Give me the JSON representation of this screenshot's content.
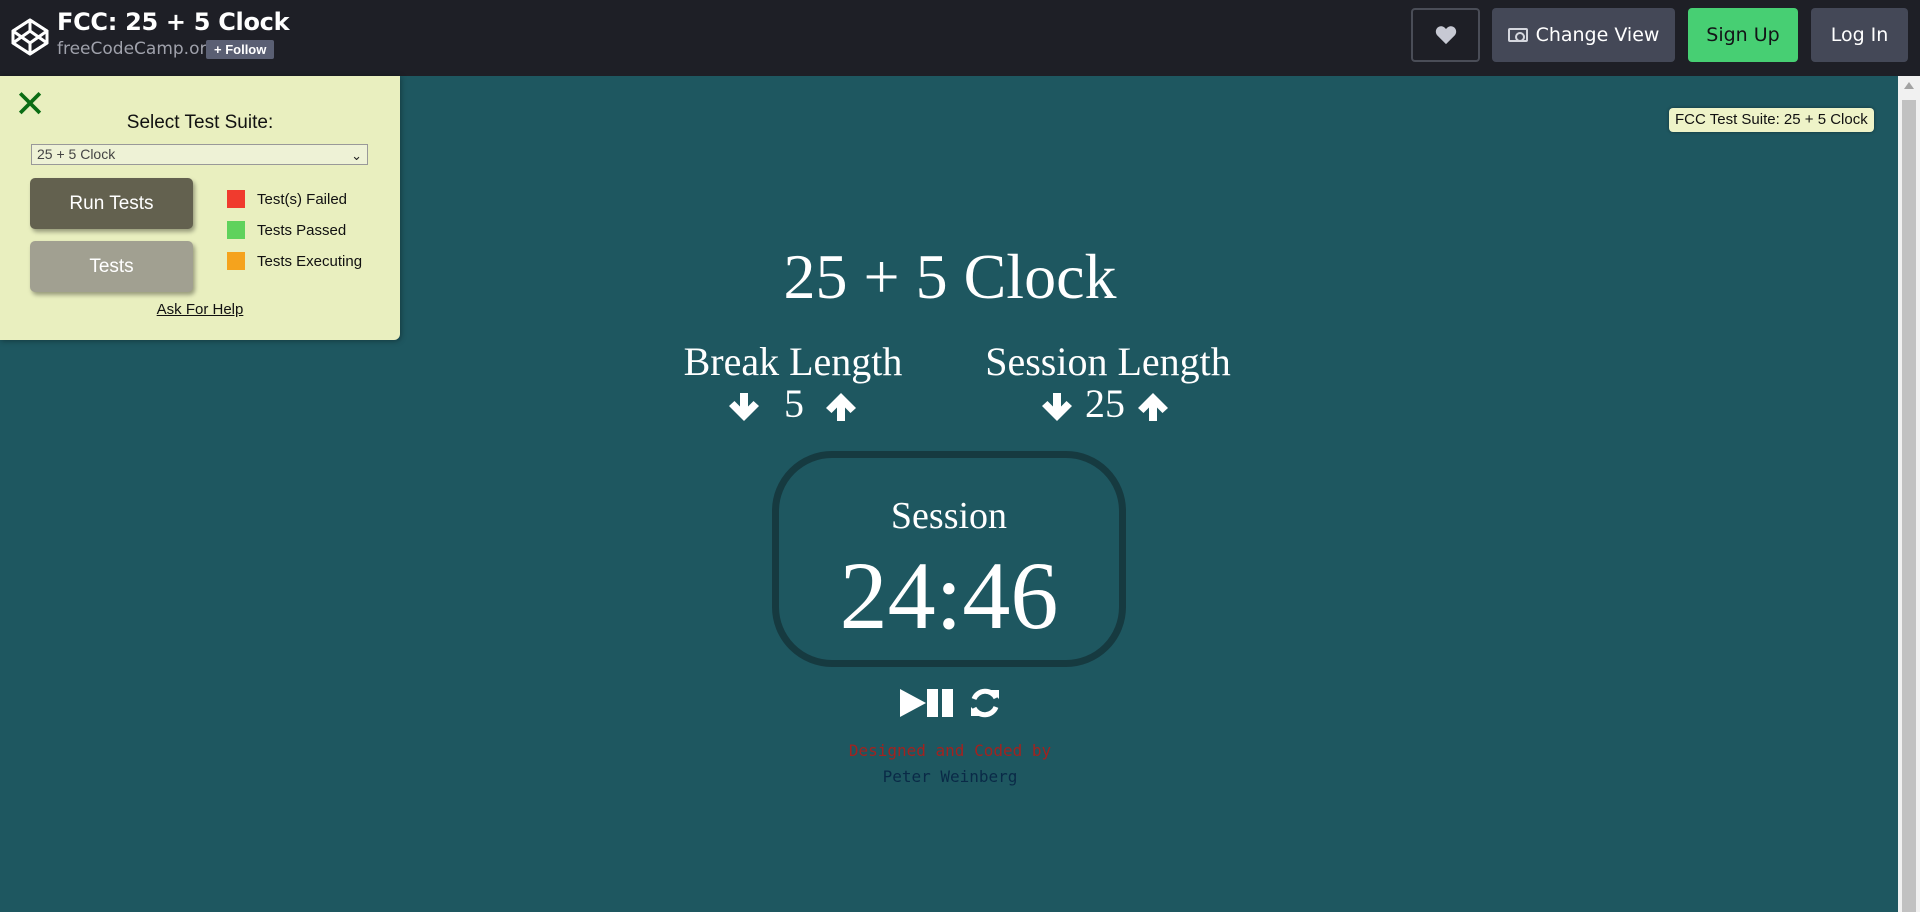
{
  "header": {
    "pen_title": "FCC: 25 + 5 Clock",
    "owner": "freeCodeCamp.org",
    "follow_label": "+ Follow",
    "change_view_label": "Change View",
    "sign_up_label": "Sign Up",
    "log_in_label": "Log In"
  },
  "test_panel": {
    "close_label": "✕",
    "select_label": "Select Test Suite:",
    "selected_suite": "25 + 5 Clock",
    "run_tests_label": "Run Tests",
    "tests_label": "Tests",
    "legend": [
      {
        "label": "Test(s) Failed",
        "color": "#f03b2e"
      },
      {
        "label": "Tests Passed",
        "color": "#5fd25c"
      },
      {
        "label": "Tests Executing",
        "color": "#f5a31d"
      }
    ],
    "help_link": "Ask For Help"
  },
  "suite_badge": "FCC Test Suite: 25 + 5 Clock",
  "clock": {
    "title": "25 + 5 Clock",
    "break_label": "Break Length",
    "break_value": "5",
    "session_label": "Session Length",
    "session_value": "25",
    "timer_label": "Session",
    "time_left": "24:46",
    "credit_line1": "Designed and Coded by",
    "credit_line2": "Peter Weinberg"
  },
  "colors": {
    "background": "#1e5760",
    "credit_line1": "#a2221f",
    "credit_line2": "#0a2a47",
    "sign_up": "#47cf73"
  }
}
